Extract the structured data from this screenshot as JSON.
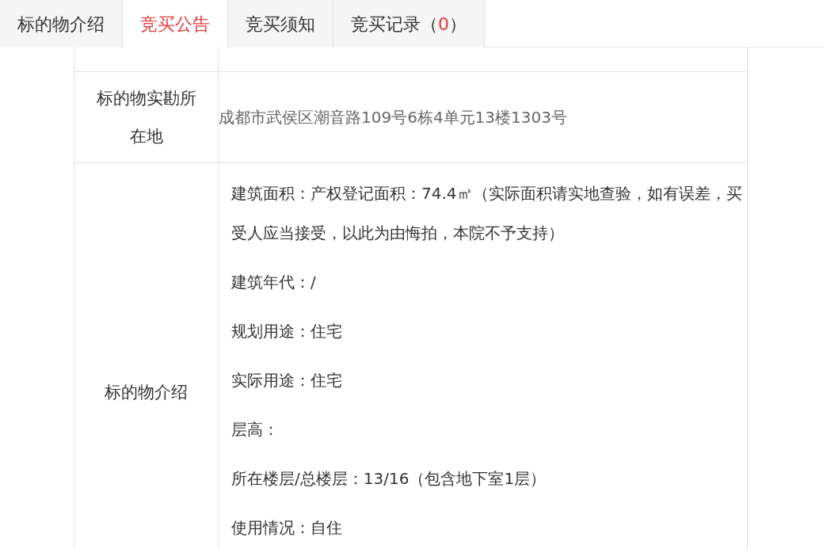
{
  "tabs": [
    {
      "label": "标的物介绍",
      "selected": false
    },
    {
      "label": "竞买公告",
      "selected": true
    },
    {
      "label": "竞买须知",
      "selected": false
    },
    {
      "label": "竞买记录（",
      "count": "0",
      "suffix": "）",
      "selected": false
    }
  ],
  "rows": [
    {
      "label": "标的物实勘所在地",
      "value": "成都市武侯区潮音路109号6栋4单元13楼1303号"
    }
  ],
  "intro": {
    "label": "标的物介绍",
    "lines": [
      "建筑面积：产权登记面积：74.4㎡（实际面积请实地查验，如有误差，买受人应当接受，以此为由悔拍，本院不予支持）",
      "建筑年代：/",
      "规划用途：住宅",
      "实际用途：住宅",
      "层高：",
      "所在楼层/总楼层：13/16（包含地下室1层）",
      "使用情况：自住"
    ]
  }
}
